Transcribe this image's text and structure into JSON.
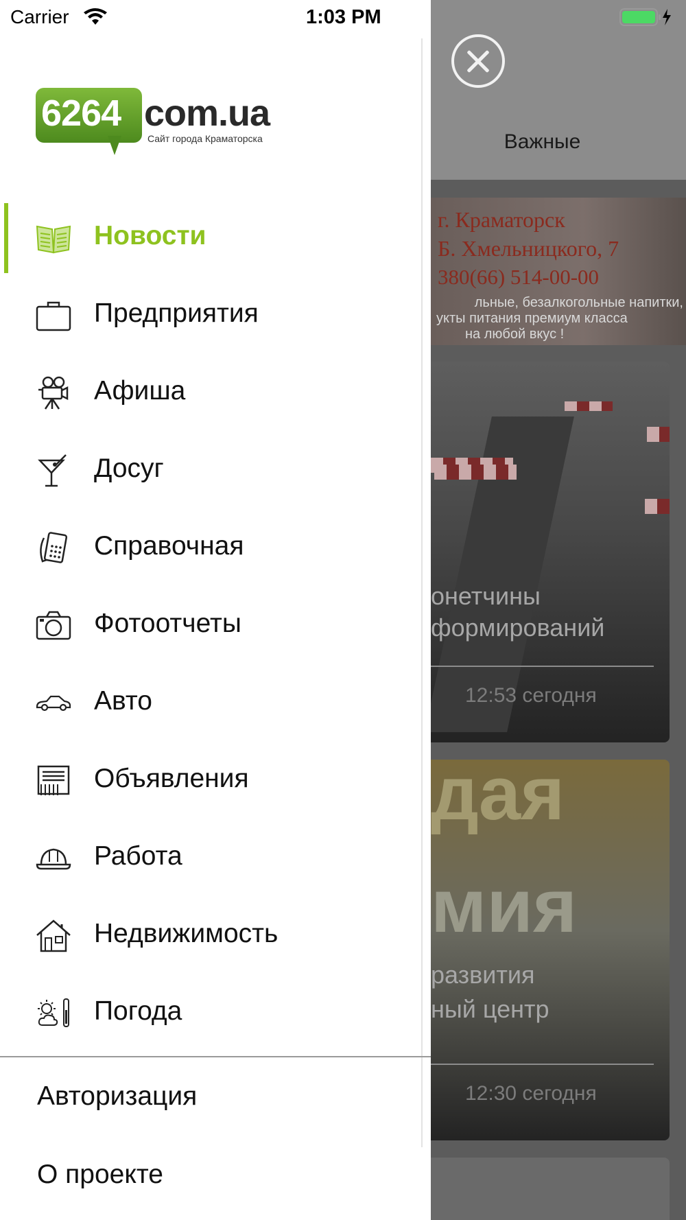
{
  "status_bar": {
    "carrier": "Carrier",
    "time": "1:03 PM"
  },
  "background": {
    "tab_label": "Важные",
    "banner": {
      "line1": "г. Краматорск",
      "line2": "Б. Хмельницкого, 7",
      "line3": "380(66) 514-00-00",
      "line4": "льные, безалкогольные напитки,",
      "line5": "укты питания премиум класса",
      "line6": "на любой вкус !"
    },
    "cards": [
      {
        "title_line1": "онетчины",
        "title_line2": "формирований",
        "time": "12:53 сегодня"
      },
      {
        "title_line1": "развития",
        "title_line2": "ный центр",
        "time": "12:30 сегодня"
      }
    ]
  },
  "drawer": {
    "logo": {
      "number": "6264",
      "domain": "com.ua",
      "subtitle": "Сайт города Краматорска"
    },
    "menu": [
      {
        "label": "Новости",
        "icon": "newspaper-icon",
        "active": true
      },
      {
        "label": "Предприятия",
        "icon": "briefcase-icon"
      },
      {
        "label": "Афиша",
        "icon": "movie-camera-icon"
      },
      {
        "label": "Досуг",
        "icon": "cocktail-icon"
      },
      {
        "label": "Справочная",
        "icon": "phone-icon"
      },
      {
        "label": "Фотоотчеты",
        "icon": "camera-icon"
      },
      {
        "label": "Авто",
        "icon": "car-icon"
      },
      {
        "label": "Объявления",
        "icon": "classifieds-icon"
      },
      {
        "label": "Работа",
        "icon": "hard-hat-icon"
      },
      {
        "label": "Недвижимость",
        "icon": "house-icon"
      },
      {
        "label": "Погода",
        "icon": "weather-icon"
      }
    ],
    "footer": {
      "login": "Авторизация",
      "about": "О проекте"
    },
    "accent_color": "#8ec21f"
  }
}
